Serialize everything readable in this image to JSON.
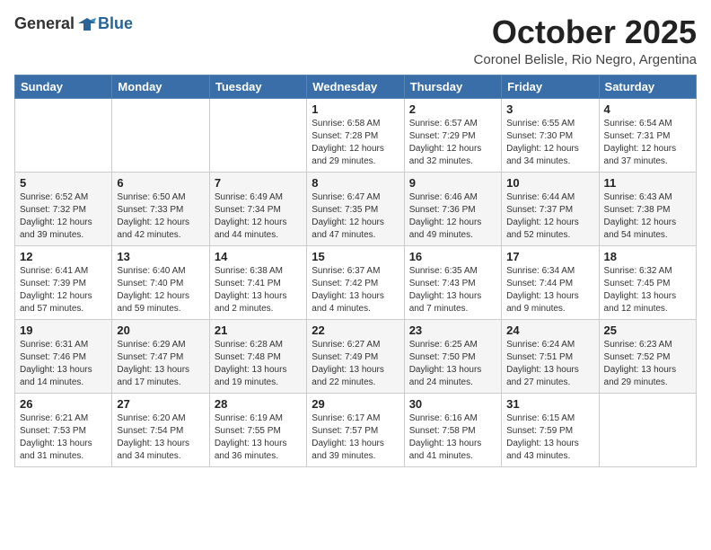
{
  "header": {
    "logo_general": "General",
    "logo_blue": "Blue",
    "month_title": "October 2025",
    "subtitle": "Coronel Belisle, Rio Negro, Argentina"
  },
  "days_of_week": [
    "Sunday",
    "Monday",
    "Tuesday",
    "Wednesday",
    "Thursday",
    "Friday",
    "Saturday"
  ],
  "weeks": [
    [
      {
        "day": "",
        "info": ""
      },
      {
        "day": "",
        "info": ""
      },
      {
        "day": "",
        "info": ""
      },
      {
        "day": "1",
        "info": "Sunrise: 6:58 AM\nSunset: 7:28 PM\nDaylight: 12 hours\nand 29 minutes."
      },
      {
        "day": "2",
        "info": "Sunrise: 6:57 AM\nSunset: 7:29 PM\nDaylight: 12 hours\nand 32 minutes."
      },
      {
        "day": "3",
        "info": "Sunrise: 6:55 AM\nSunset: 7:30 PM\nDaylight: 12 hours\nand 34 minutes."
      },
      {
        "day": "4",
        "info": "Sunrise: 6:54 AM\nSunset: 7:31 PM\nDaylight: 12 hours\nand 37 minutes."
      }
    ],
    [
      {
        "day": "5",
        "info": "Sunrise: 6:52 AM\nSunset: 7:32 PM\nDaylight: 12 hours\nand 39 minutes."
      },
      {
        "day": "6",
        "info": "Sunrise: 6:50 AM\nSunset: 7:33 PM\nDaylight: 12 hours\nand 42 minutes."
      },
      {
        "day": "7",
        "info": "Sunrise: 6:49 AM\nSunset: 7:34 PM\nDaylight: 12 hours\nand 44 minutes."
      },
      {
        "day": "8",
        "info": "Sunrise: 6:47 AM\nSunset: 7:35 PM\nDaylight: 12 hours\nand 47 minutes."
      },
      {
        "day": "9",
        "info": "Sunrise: 6:46 AM\nSunset: 7:36 PM\nDaylight: 12 hours\nand 49 minutes."
      },
      {
        "day": "10",
        "info": "Sunrise: 6:44 AM\nSunset: 7:37 PM\nDaylight: 12 hours\nand 52 minutes."
      },
      {
        "day": "11",
        "info": "Sunrise: 6:43 AM\nSunset: 7:38 PM\nDaylight: 12 hours\nand 54 minutes."
      }
    ],
    [
      {
        "day": "12",
        "info": "Sunrise: 6:41 AM\nSunset: 7:39 PM\nDaylight: 12 hours\nand 57 minutes."
      },
      {
        "day": "13",
        "info": "Sunrise: 6:40 AM\nSunset: 7:40 PM\nDaylight: 12 hours\nand 59 minutes."
      },
      {
        "day": "14",
        "info": "Sunrise: 6:38 AM\nSunset: 7:41 PM\nDaylight: 13 hours\nand 2 minutes."
      },
      {
        "day": "15",
        "info": "Sunrise: 6:37 AM\nSunset: 7:42 PM\nDaylight: 13 hours\nand 4 minutes."
      },
      {
        "day": "16",
        "info": "Sunrise: 6:35 AM\nSunset: 7:43 PM\nDaylight: 13 hours\nand 7 minutes."
      },
      {
        "day": "17",
        "info": "Sunrise: 6:34 AM\nSunset: 7:44 PM\nDaylight: 13 hours\nand 9 minutes."
      },
      {
        "day": "18",
        "info": "Sunrise: 6:32 AM\nSunset: 7:45 PM\nDaylight: 13 hours\nand 12 minutes."
      }
    ],
    [
      {
        "day": "19",
        "info": "Sunrise: 6:31 AM\nSunset: 7:46 PM\nDaylight: 13 hours\nand 14 minutes."
      },
      {
        "day": "20",
        "info": "Sunrise: 6:29 AM\nSunset: 7:47 PM\nDaylight: 13 hours\nand 17 minutes."
      },
      {
        "day": "21",
        "info": "Sunrise: 6:28 AM\nSunset: 7:48 PM\nDaylight: 13 hours\nand 19 minutes."
      },
      {
        "day": "22",
        "info": "Sunrise: 6:27 AM\nSunset: 7:49 PM\nDaylight: 13 hours\nand 22 minutes."
      },
      {
        "day": "23",
        "info": "Sunrise: 6:25 AM\nSunset: 7:50 PM\nDaylight: 13 hours\nand 24 minutes."
      },
      {
        "day": "24",
        "info": "Sunrise: 6:24 AM\nSunset: 7:51 PM\nDaylight: 13 hours\nand 27 minutes."
      },
      {
        "day": "25",
        "info": "Sunrise: 6:23 AM\nSunset: 7:52 PM\nDaylight: 13 hours\nand 29 minutes."
      }
    ],
    [
      {
        "day": "26",
        "info": "Sunrise: 6:21 AM\nSunset: 7:53 PM\nDaylight: 13 hours\nand 31 minutes."
      },
      {
        "day": "27",
        "info": "Sunrise: 6:20 AM\nSunset: 7:54 PM\nDaylight: 13 hours\nand 34 minutes."
      },
      {
        "day": "28",
        "info": "Sunrise: 6:19 AM\nSunset: 7:55 PM\nDaylight: 13 hours\nand 36 minutes."
      },
      {
        "day": "29",
        "info": "Sunrise: 6:17 AM\nSunset: 7:57 PM\nDaylight: 13 hours\nand 39 minutes."
      },
      {
        "day": "30",
        "info": "Sunrise: 6:16 AM\nSunset: 7:58 PM\nDaylight: 13 hours\nand 41 minutes."
      },
      {
        "day": "31",
        "info": "Sunrise: 6:15 AM\nSunset: 7:59 PM\nDaylight: 13 hours\nand 43 minutes."
      },
      {
        "day": "",
        "info": ""
      }
    ]
  ]
}
